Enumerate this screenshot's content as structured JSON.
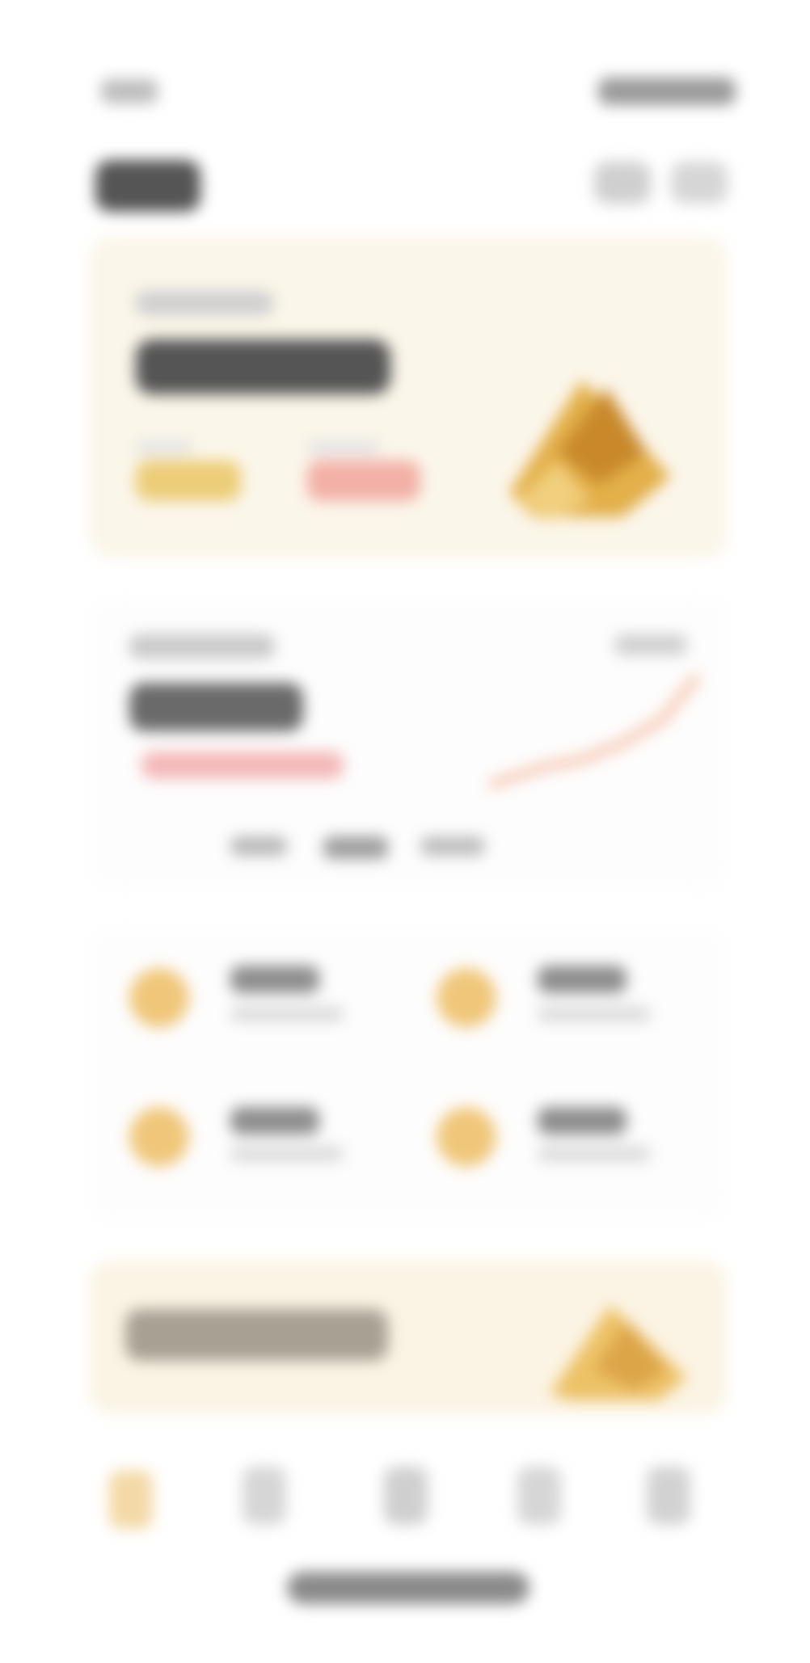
{
  "status_bar": {
    "time": "",
    "icons": [
      "signal-icon",
      "wifi-icon",
      "battery-icon"
    ]
  },
  "header": {
    "logo": "",
    "actions": [
      "bell-icon",
      "profile-icon"
    ]
  },
  "hero": {
    "label": "",
    "value": "",
    "stats": [
      {
        "label": "",
        "value": ""
      },
      {
        "label": "",
        "value": ""
      }
    ],
    "image": "gold-bars-image"
  },
  "portfolio": {
    "label": "",
    "value": "",
    "change": "",
    "tag": "",
    "tabs": [
      "",
      "",
      ""
    ]
  },
  "quick_actions": [
    {
      "icon": "action-icon-1",
      "title": "",
      "subtitle": ""
    },
    {
      "icon": "action-icon-2",
      "title": "",
      "subtitle": ""
    },
    {
      "icon": "action-icon-3",
      "title": "",
      "subtitle": ""
    },
    {
      "icon": "action-icon-4",
      "title": "",
      "subtitle": ""
    }
  ],
  "promo": {
    "text": "",
    "image": "gold-coins-image"
  },
  "bottom_nav": [
    "home-icon",
    "market-icon",
    "trade-icon",
    "wallet-icon",
    "profile-icon"
  ],
  "colors": {
    "accent": "#e0a830",
    "negative": "#f2a49a",
    "card_bg": "#fbf6ea",
    "background": "#ffffff"
  }
}
